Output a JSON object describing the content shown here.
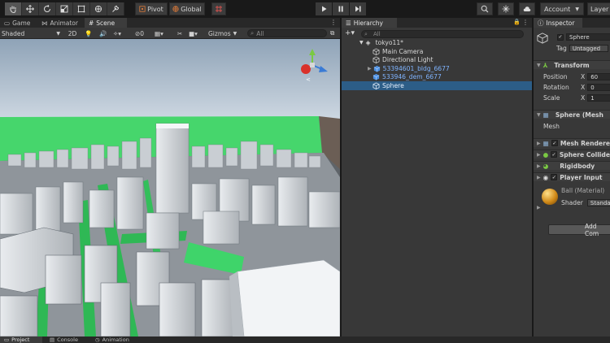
{
  "toolbar": {
    "pivot_label": "Pivot",
    "global_label": "Global",
    "account_label": "Account",
    "layers_label": "Layer"
  },
  "scene_tabs": [
    {
      "label": "Game"
    },
    {
      "label": "Animator"
    },
    {
      "label": "Scene"
    }
  ],
  "scene_toolbar": {
    "draw_mode": "Shaded",
    "mode_2d": "2D",
    "gizmos_label": "Gizmos",
    "search_value": "All"
  },
  "hierarchy": {
    "tab_label": "Hierarchy",
    "search_value": "All",
    "scene_name": "tokyo11*",
    "items": [
      {
        "label": "Main Camera"
      },
      {
        "label": "Directional Light"
      },
      {
        "label": "53394601_bldg_6677"
      },
      {
        "label": "533946_dem_6677"
      },
      {
        "label": "Sphere"
      }
    ]
  },
  "inspector": {
    "tab_label": "Inspector",
    "object_name": "Sphere",
    "tag_label": "Tag",
    "tag_value": "Untagged",
    "transform": {
      "title": "Transform",
      "position_label": "Position",
      "rotation_label": "Rotation",
      "scale_label": "Scale",
      "axis_x": "X",
      "position_x": "60",
      "rotation_x": "0",
      "scale_x": "1"
    },
    "mesh_filter": {
      "title": "Sphere (Mesh",
      "mesh_label": "Mesh"
    },
    "components": [
      {
        "title": "Mesh Rendere"
      },
      {
        "title": "Sphere Collide"
      },
      {
        "title": "Rigidbody"
      },
      {
        "title": "Player Input"
      }
    ],
    "material": {
      "name": "Ball (Material)",
      "shader_label": "Shader",
      "shader_value": "Standa"
    },
    "add_component_label": "Add Com"
  },
  "bottom_tabs": [
    {
      "label": "Project"
    },
    {
      "label": "Console"
    },
    {
      "label": "Animation"
    }
  ],
  "colors": {
    "selection": "#2c5d87",
    "ground_green": "#3ccf62",
    "sky_top": "#a9b7c6",
    "prefab_blue": "#7fb4ff"
  }
}
